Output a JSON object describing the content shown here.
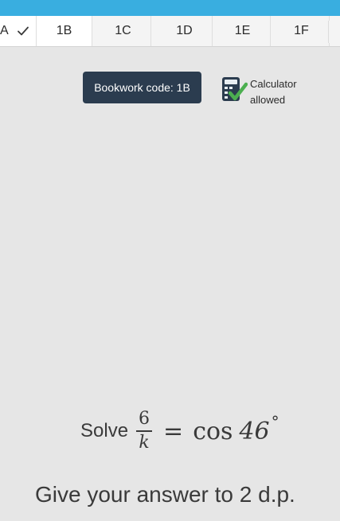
{
  "tabs": [
    {
      "label": "A",
      "state": "done",
      "icon": "check-icon"
    },
    {
      "label": "1B",
      "state": "active"
    },
    {
      "label": "1C",
      "state": "inactive"
    },
    {
      "label": "1D",
      "state": "inactive"
    },
    {
      "label": "1E",
      "state": "inactive"
    },
    {
      "label": "1F",
      "state": "inactive"
    }
  ],
  "bookwork": {
    "label": "Bookwork code: 1B"
  },
  "calculator": {
    "icon": "calculator-allowed-icon",
    "line1": "Calculator",
    "line2": "allowed"
  },
  "question": {
    "verb": "Solve",
    "numerator": "6",
    "denominator": "k",
    "equals": "=",
    "function": "cos",
    "angle": "46",
    "degree_symbol": "°",
    "instruction": "Give your answer to 2 d.p."
  },
  "colors": {
    "top_strip": "#39aee0",
    "bookwork_bg": "#2b3c4f",
    "check_green": "#4caf50",
    "calc_blue": "#2b3c4f"
  }
}
